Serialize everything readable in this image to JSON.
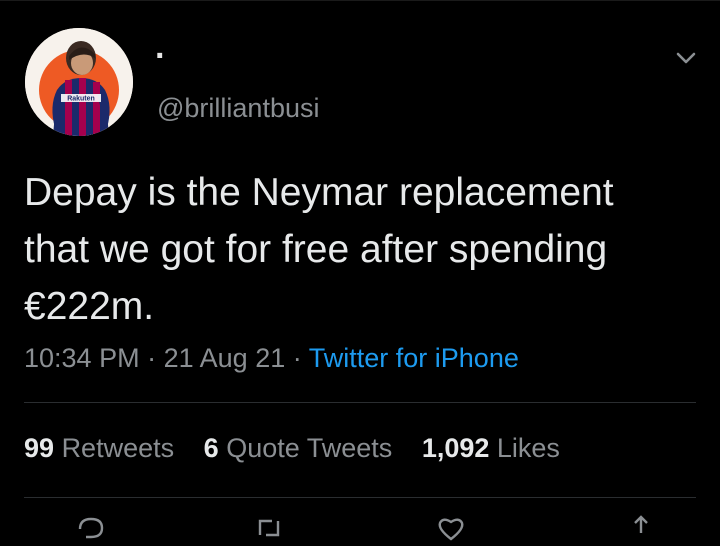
{
  "tweet": {
    "author": {
      "display_name": "·",
      "handle": "@brilliantbusi",
      "avatar_shirt_text": "Rakuten"
    },
    "text": "Depay is the Neymar replacement\nthat we got for free after spending\n€222m.",
    "time": "10:34 PM",
    "date": "21 Aug 21",
    "source": "Twitter for iPhone",
    "separator": "·",
    "stats": {
      "retweets_count": "99",
      "retweets_label": "Retweets",
      "quote_count": "6",
      "quote_label": "Quote Tweets",
      "likes_count": "1,092",
      "likes_label": "Likes"
    }
  },
  "icons": {
    "menu": "chevron-down-icon",
    "reply": "reply-icon",
    "retweet": "retweet-icon",
    "like": "heart-icon",
    "share": "share-icon"
  },
  "colors": {
    "background": "#000000",
    "text": "#e7e9ea",
    "secondary": "#8b8f93",
    "link": "#1d9bf0",
    "divider": "#2a2d30"
  }
}
